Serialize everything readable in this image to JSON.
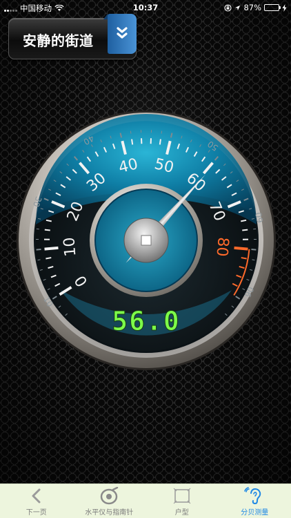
{
  "status_bar": {
    "carrier": "中国移动",
    "time": "10:37",
    "battery": "87%"
  },
  "mode_button": {
    "label": "安静的街道"
  },
  "gauge": {
    "reading": "56.0",
    "needle_value": 60.5,
    "inner_scale_labels": [
      "0",
      "10",
      "20",
      "30",
      "40",
      "50",
      "60",
      "70",
      "80"
    ],
    "outer_scale_labels": [
      "10",
      "30",
      "40",
      "50",
      "60",
      "90"
    ],
    "colors": {
      "display_digits": "#7dff4a",
      "danger": "#ff6a2b",
      "dial_blue": "#0f7fa6"
    }
  },
  "tab_bar": {
    "items": [
      {
        "label": "下一页",
        "icon": "chevron-left-icon",
        "active": false
      },
      {
        "label": "水平仪与指南针",
        "icon": "compass-icon",
        "active": false
      },
      {
        "label": "户型",
        "icon": "floorplan-icon",
        "active": false
      },
      {
        "label": "分贝测量",
        "icon": "ear-sound-icon",
        "active": true
      }
    ],
    "active_color": "#1e88e5"
  }
}
